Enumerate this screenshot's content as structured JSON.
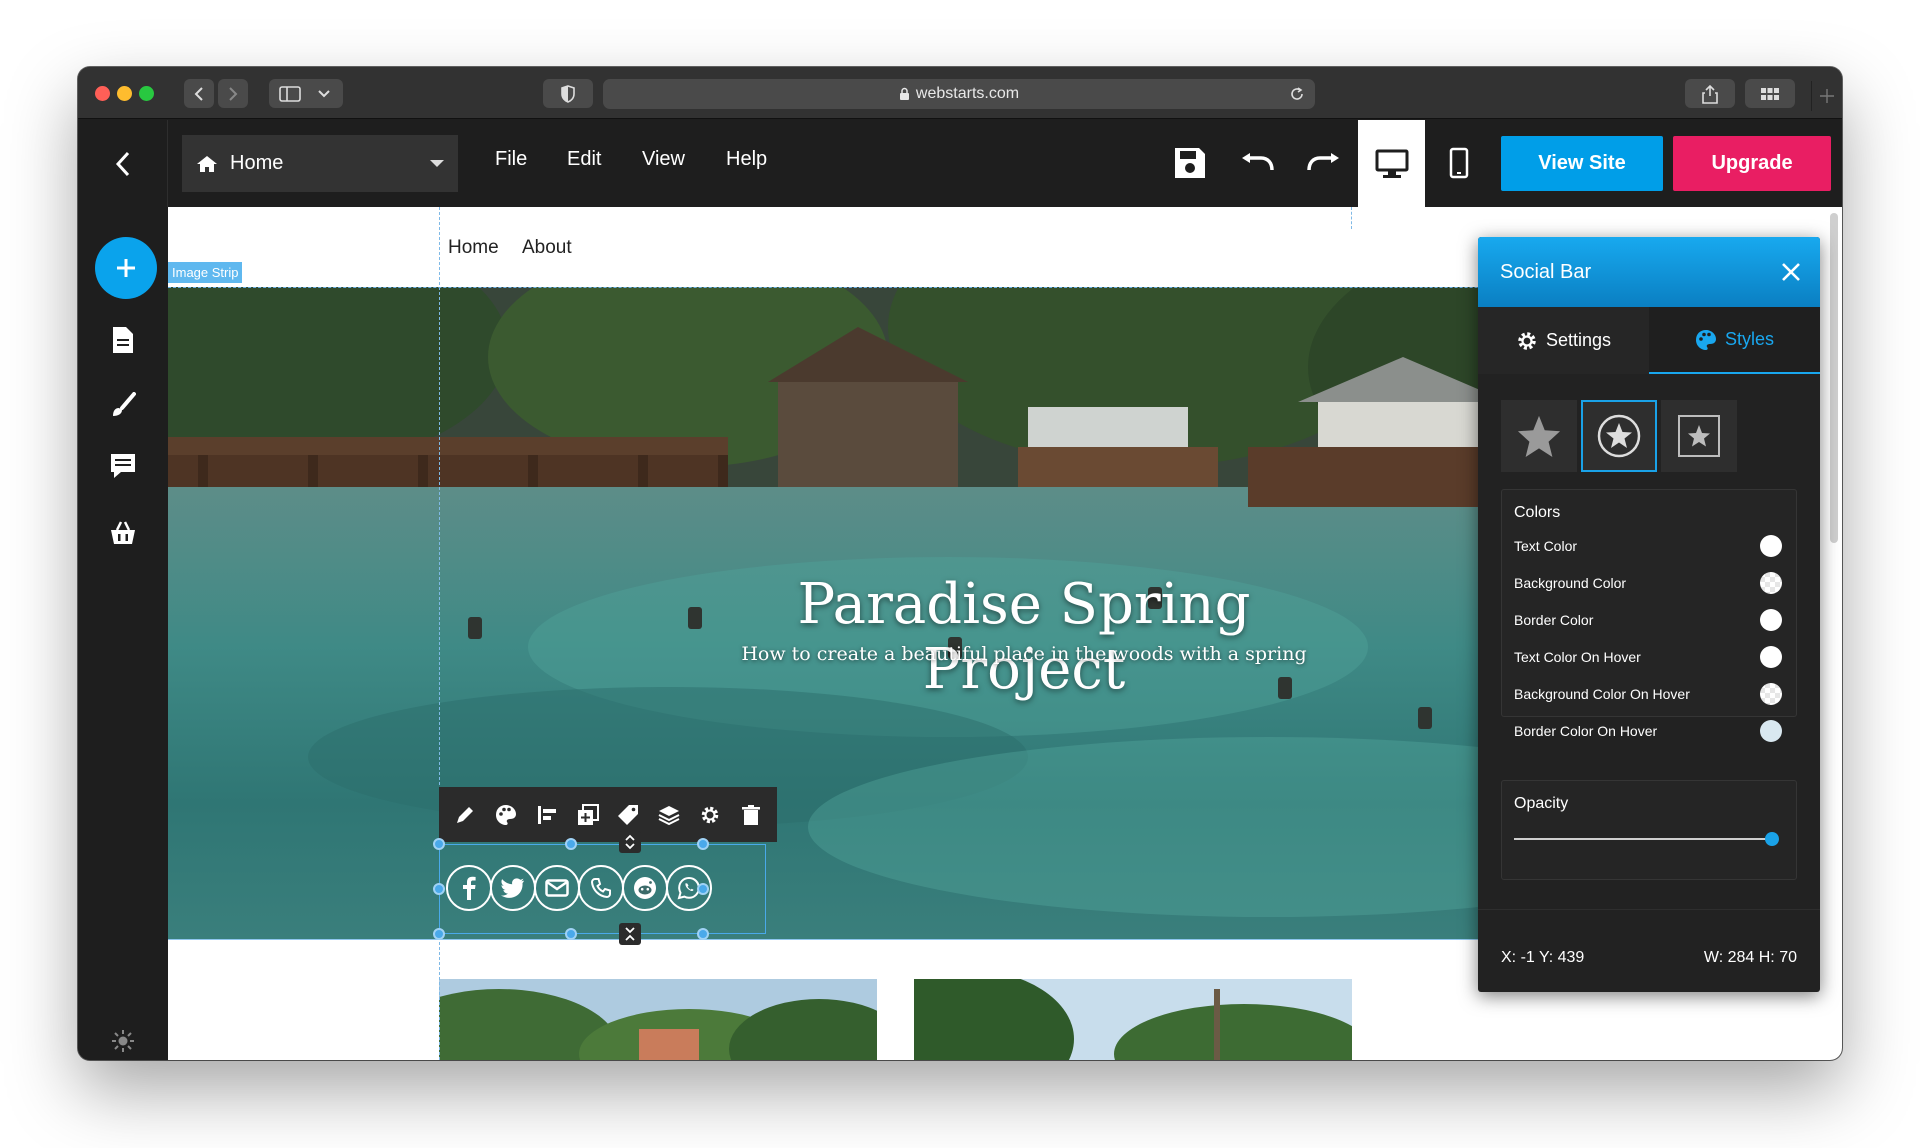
{
  "browser": {
    "url": "webstarts.com"
  },
  "toolbar": {
    "page_select": "Home",
    "menu": [
      "File",
      "Edit",
      "View",
      "Help"
    ],
    "view_site": "View Site",
    "upgrade": "Upgrade"
  },
  "site": {
    "nav": [
      "Home",
      "About"
    ],
    "strip_label": "Image Strip",
    "hero_title": "Paradise Spring Project",
    "hero_subtitle": "How to create a beautiful place in the woods with a spring",
    "social_icons": [
      "facebook-icon",
      "twitter-icon",
      "email-icon",
      "phone-icon",
      "reddit-icon",
      "whatsapp-icon"
    ]
  },
  "panel": {
    "title": "Social Bar",
    "tab_settings": "Settings",
    "tab_styles": "Styles",
    "active_tab": "Styles",
    "colors_title": "Colors",
    "colors": [
      {
        "label": "Text Color",
        "swatch": "#ffffff"
      },
      {
        "label": "Background Color",
        "swatch": "transparent"
      },
      {
        "label": "Border Color",
        "swatch": "#ffffff"
      },
      {
        "label": "Text Color On Hover",
        "swatch": "#ffffff"
      },
      {
        "label": "Background Color On Hover",
        "swatch": "transparent"
      },
      {
        "label": "Border Color On Hover",
        "swatch": "#d9e8f0"
      }
    ],
    "opacity_label": "Opacity",
    "opacity_value": 1.0,
    "status_xy": "X: -1 Y: 439",
    "status_wh": "W: 284 H: 70"
  },
  "colors": {
    "accent": "#009ee8",
    "upgrade": "#e91e63",
    "selection": "#4aa9ea"
  }
}
